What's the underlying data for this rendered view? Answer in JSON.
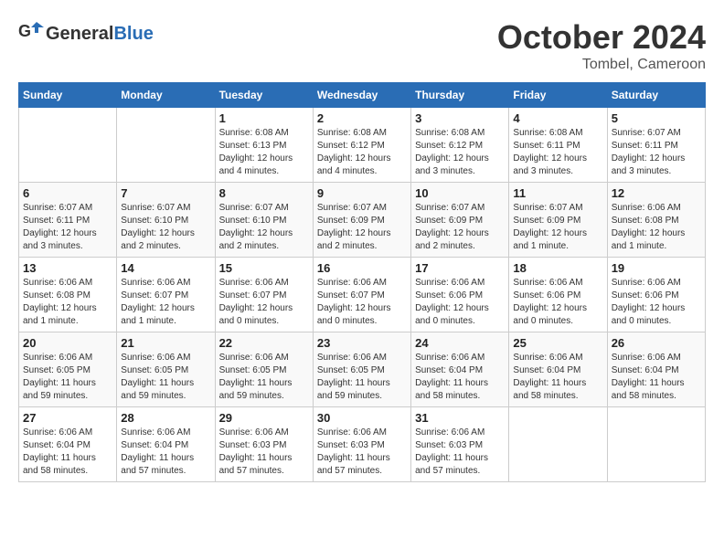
{
  "header": {
    "logo_general": "General",
    "logo_blue": "Blue",
    "title": "October 2024",
    "subtitle": "Tombel, Cameroon"
  },
  "weekdays": [
    "Sunday",
    "Monday",
    "Tuesday",
    "Wednesday",
    "Thursday",
    "Friday",
    "Saturday"
  ],
  "weeks": [
    [
      {
        "day": "",
        "info": ""
      },
      {
        "day": "",
        "info": ""
      },
      {
        "day": "1",
        "info": "Sunrise: 6:08 AM\nSunset: 6:13 PM\nDaylight: 12 hours\nand 4 minutes."
      },
      {
        "day": "2",
        "info": "Sunrise: 6:08 AM\nSunset: 6:12 PM\nDaylight: 12 hours\nand 4 minutes."
      },
      {
        "day": "3",
        "info": "Sunrise: 6:08 AM\nSunset: 6:12 PM\nDaylight: 12 hours\nand 3 minutes."
      },
      {
        "day": "4",
        "info": "Sunrise: 6:08 AM\nSunset: 6:11 PM\nDaylight: 12 hours\nand 3 minutes."
      },
      {
        "day": "5",
        "info": "Sunrise: 6:07 AM\nSunset: 6:11 PM\nDaylight: 12 hours\nand 3 minutes."
      }
    ],
    [
      {
        "day": "6",
        "info": "Sunrise: 6:07 AM\nSunset: 6:11 PM\nDaylight: 12 hours\nand 3 minutes."
      },
      {
        "day": "7",
        "info": "Sunrise: 6:07 AM\nSunset: 6:10 PM\nDaylight: 12 hours\nand 2 minutes."
      },
      {
        "day": "8",
        "info": "Sunrise: 6:07 AM\nSunset: 6:10 PM\nDaylight: 12 hours\nand 2 minutes."
      },
      {
        "day": "9",
        "info": "Sunrise: 6:07 AM\nSunset: 6:09 PM\nDaylight: 12 hours\nand 2 minutes."
      },
      {
        "day": "10",
        "info": "Sunrise: 6:07 AM\nSunset: 6:09 PM\nDaylight: 12 hours\nand 2 minutes."
      },
      {
        "day": "11",
        "info": "Sunrise: 6:07 AM\nSunset: 6:09 PM\nDaylight: 12 hours\nand 1 minute."
      },
      {
        "day": "12",
        "info": "Sunrise: 6:06 AM\nSunset: 6:08 PM\nDaylight: 12 hours\nand 1 minute."
      }
    ],
    [
      {
        "day": "13",
        "info": "Sunrise: 6:06 AM\nSunset: 6:08 PM\nDaylight: 12 hours\nand 1 minute."
      },
      {
        "day": "14",
        "info": "Sunrise: 6:06 AM\nSunset: 6:07 PM\nDaylight: 12 hours\nand 1 minute."
      },
      {
        "day": "15",
        "info": "Sunrise: 6:06 AM\nSunset: 6:07 PM\nDaylight: 12 hours\nand 0 minutes."
      },
      {
        "day": "16",
        "info": "Sunrise: 6:06 AM\nSunset: 6:07 PM\nDaylight: 12 hours\nand 0 minutes."
      },
      {
        "day": "17",
        "info": "Sunrise: 6:06 AM\nSunset: 6:06 PM\nDaylight: 12 hours\nand 0 minutes."
      },
      {
        "day": "18",
        "info": "Sunrise: 6:06 AM\nSunset: 6:06 PM\nDaylight: 12 hours\nand 0 minutes."
      },
      {
        "day": "19",
        "info": "Sunrise: 6:06 AM\nSunset: 6:06 PM\nDaylight: 12 hours\nand 0 minutes."
      }
    ],
    [
      {
        "day": "20",
        "info": "Sunrise: 6:06 AM\nSunset: 6:05 PM\nDaylight: 11 hours\nand 59 minutes."
      },
      {
        "day": "21",
        "info": "Sunrise: 6:06 AM\nSunset: 6:05 PM\nDaylight: 11 hours\nand 59 minutes."
      },
      {
        "day": "22",
        "info": "Sunrise: 6:06 AM\nSunset: 6:05 PM\nDaylight: 11 hours\nand 59 minutes."
      },
      {
        "day": "23",
        "info": "Sunrise: 6:06 AM\nSunset: 6:05 PM\nDaylight: 11 hours\nand 59 minutes."
      },
      {
        "day": "24",
        "info": "Sunrise: 6:06 AM\nSunset: 6:04 PM\nDaylight: 11 hours\nand 58 minutes."
      },
      {
        "day": "25",
        "info": "Sunrise: 6:06 AM\nSunset: 6:04 PM\nDaylight: 11 hours\nand 58 minutes."
      },
      {
        "day": "26",
        "info": "Sunrise: 6:06 AM\nSunset: 6:04 PM\nDaylight: 11 hours\nand 58 minutes."
      }
    ],
    [
      {
        "day": "27",
        "info": "Sunrise: 6:06 AM\nSunset: 6:04 PM\nDaylight: 11 hours\nand 58 minutes."
      },
      {
        "day": "28",
        "info": "Sunrise: 6:06 AM\nSunset: 6:04 PM\nDaylight: 11 hours\nand 57 minutes."
      },
      {
        "day": "29",
        "info": "Sunrise: 6:06 AM\nSunset: 6:03 PM\nDaylight: 11 hours\nand 57 minutes."
      },
      {
        "day": "30",
        "info": "Sunrise: 6:06 AM\nSunset: 6:03 PM\nDaylight: 11 hours\nand 57 minutes."
      },
      {
        "day": "31",
        "info": "Sunrise: 6:06 AM\nSunset: 6:03 PM\nDaylight: 11 hours\nand 57 minutes."
      },
      {
        "day": "",
        "info": ""
      },
      {
        "day": "",
        "info": ""
      }
    ]
  ]
}
